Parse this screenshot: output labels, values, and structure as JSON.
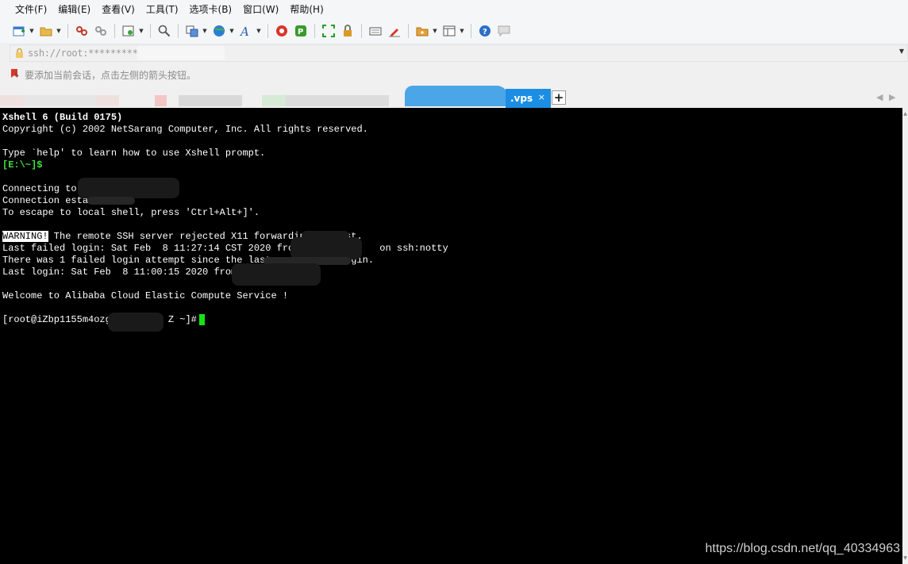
{
  "menu": [
    "文件(F)",
    "编辑(E)",
    "查看(V)",
    "工具(T)",
    "选项卡(B)",
    "窗口(W)",
    "帮助(H)"
  ],
  "toolbar_icons": [
    "new-session-icon",
    "open-folder-icon",
    "disconnect-icon",
    "reconnect-icon",
    "properties-icon",
    "search-icon",
    "transfer-icon",
    "globe-icon",
    "font-icon",
    "xftp-icon",
    "xmanager-icon",
    "fullscreen-icon",
    "lock-icon",
    "keyboard-icon",
    "highlight-icon",
    "new-tab-folder-icon",
    "layout-icon",
    "help-icon",
    "chat-icon"
  ],
  "address": {
    "text": "ssh://root:***********@"
  },
  "hint": {
    "text": "要添加当前会话，点击左侧的箭头按钮。"
  },
  "tabs": {
    "active_label": ".vps",
    "close": "×",
    "add": "+"
  },
  "terminal": {
    "lines": [
      "Xshell 6 (Build 0175)",
      "Copyright (c) 2002 NetSarang Computer, Inc. All rights reserved.",
      "",
      "Type `help' to learn how to use Xshell prompt.",
      "[E:\\~]$",
      "",
      "Connecting to                 .",
      "Connection established.",
      "To escape to local shell, press 'Ctrl+Alt+]'.",
      "",
      " The remote SSH server rejected X11 forwarding request.",
      "Last failed login: Sat Feb  8 11:27:14 CST 2020 from              on ssh:notty",
      "There was 1 failed login attempt since the last successful login.",
      "Last login: Sat Feb  8 11:00:15 2020 from",
      "",
      "Welcome to Alibaba Cloud Elastic Compute Service !",
      "",
      "[root@iZbp1155m4ozg          Z ~]#"
    ],
    "warning_label": "WARNING!"
  },
  "watermark": "https://blog.csdn.net/qq_40334963",
  "colors": {
    "terminal_bg": "#000000",
    "prompt_green": "#3ee33e",
    "cursor_green": "#14e414",
    "tab_active": "#1b8ee3"
  }
}
